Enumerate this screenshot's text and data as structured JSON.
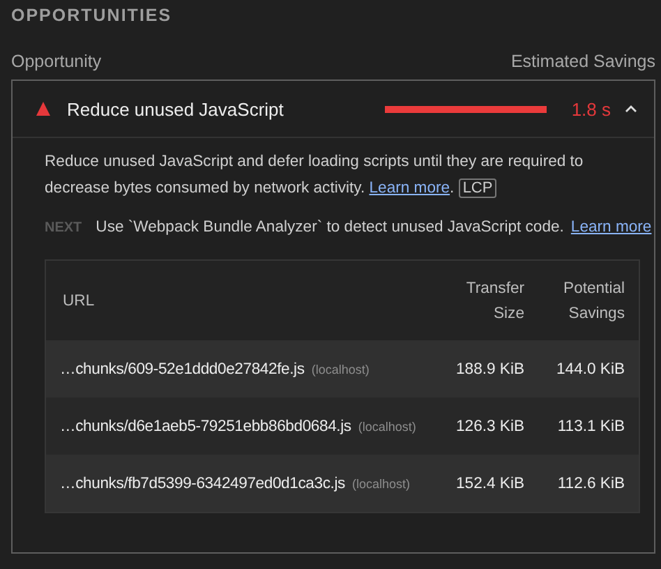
{
  "section_title": "OPPORTUNITIES",
  "header": {
    "left": "Opportunity",
    "right": "Estimated Savings"
  },
  "audit": {
    "title": "Reduce unused JavaScript",
    "savings": "1.8 s",
    "expanded": true,
    "description": "Reduce unused JavaScript and defer loading scripts until they are required to decrease bytes consumed by network activity.",
    "learn_more": "Learn more",
    "after_link": ".",
    "metric_tag": "LCP",
    "stack_pack": {
      "logo": "NEXT",
      "text": "Use `Webpack Bundle Analyzer` to detect unused JavaScript code.",
      "link": "Learn more"
    },
    "table": {
      "columns": [
        "URL",
        "Transfer Size",
        "Potential Savings"
      ],
      "rows": [
        {
          "url": "…chunks/609-52e1ddd0e27842fe.js",
          "host": "(localhost)",
          "transfer": "188.9 KiB",
          "savings": "144.0 KiB"
        },
        {
          "url": "…chunks/d6e1aeb5-79251ebb86bd0684.js",
          "host": "(localhost)",
          "transfer": "126.3 KiB",
          "savings": "113.1 KiB"
        },
        {
          "url": "…chunks/fb7d5399-6342497ed0d1ca3c.js",
          "host": "(localhost)",
          "transfer": "152.4 KiB",
          "savings": "112.6 KiB"
        }
      ]
    }
  }
}
